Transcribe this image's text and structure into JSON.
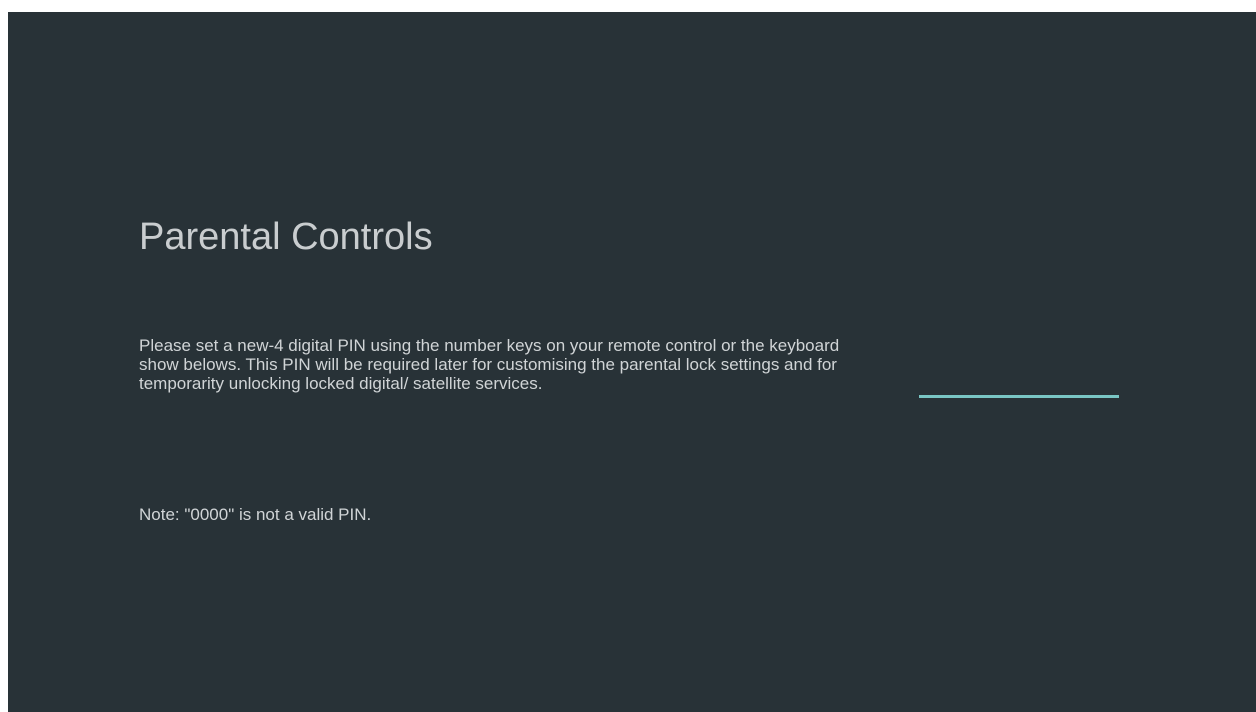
{
  "screen": {
    "title": "Parental Controls",
    "description": "Please set a new-4 digital PIN using the number keys on your remote control or the keyboard show belows. This PIN will be required later for customising the parental lock settings and for temporarity unlocking locked digital/ satellite services.",
    "note": "Note: \"0000\" is not a valid PIN."
  },
  "pin_entry": {
    "value": "",
    "underline_color": "#79c6c4"
  },
  "colors": {
    "background": "#283237",
    "text": "#d0d4d6",
    "accent": "#79c6c4"
  }
}
